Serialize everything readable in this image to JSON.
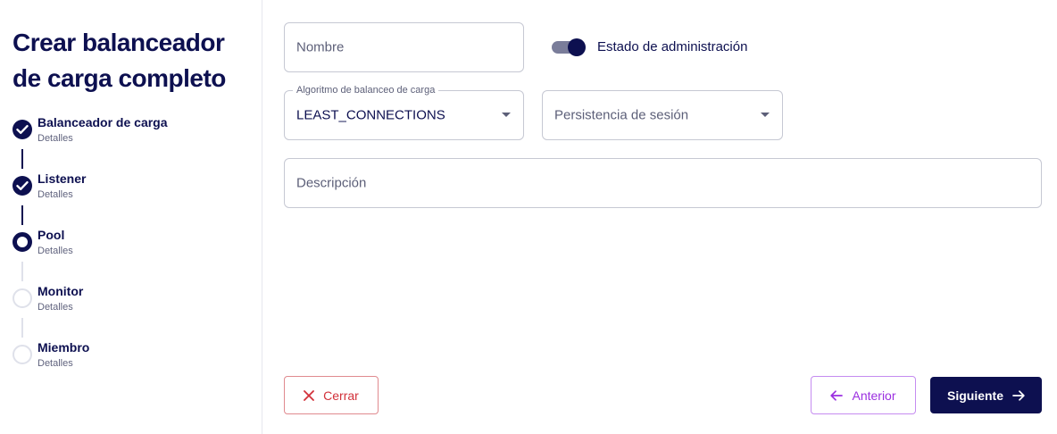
{
  "page": {
    "title_line1": "Crear balanceador",
    "title_line2": "de carga completo"
  },
  "steps": [
    {
      "title": "Balanceador de carga",
      "subtitle": "Detalles",
      "status": "done"
    },
    {
      "title": "Listener",
      "subtitle": "Detalles",
      "status": "done"
    },
    {
      "title": "Pool",
      "subtitle": "Detalles",
      "status": "current"
    },
    {
      "title": "Monitor",
      "subtitle": "Detalles",
      "status": "todo"
    },
    {
      "title": "Miembro",
      "subtitle": "Detalles",
      "status": "todo"
    }
  ],
  "form": {
    "name": {
      "placeholder": "Nombre",
      "value": ""
    },
    "admin_state": {
      "label": "Estado de administración",
      "enabled": true
    },
    "algorithm": {
      "label": "Algoritmo de balanceo de carga",
      "value": "LEAST_CONNECTIONS"
    },
    "persistence": {
      "placeholder": "Persistencia de sesión",
      "value": ""
    },
    "description": {
      "placeholder": "Descripción",
      "value": ""
    }
  },
  "actions": {
    "cancel_label": "Cerrar",
    "prev_label": "Anterior",
    "next_label": "Siguiente"
  },
  "colors": {
    "primary": "#0d1050",
    "danger": "#d2313a",
    "secondary": "#9b2fe0",
    "border": "#c6c8d3"
  },
  "icons": {
    "done_step": "check-icon",
    "cancel": "close-icon",
    "prev": "arrow-left-icon",
    "next": "arrow-right-icon",
    "select": "chevron-down-icon"
  }
}
